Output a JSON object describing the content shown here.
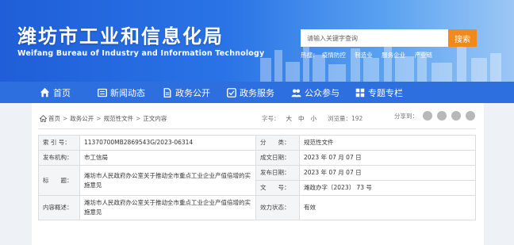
{
  "header": {
    "title": "潍坊市工业和信息化局",
    "subtitle": "Weifang Bureau of Industry and Information Technology",
    "search_placeholder": "请输入关键字查询",
    "search_button": "搜索",
    "hot_label": "热搜：",
    "hot_items": [
      "疫情防控",
      "制造业",
      "服务企业",
      "产业链"
    ]
  },
  "nav": {
    "items": [
      {
        "label": "首页",
        "icon": "home-icon"
      },
      {
        "label": "新闻动态",
        "icon": "news-icon"
      },
      {
        "label": "政务公开",
        "icon": "document-icon"
      },
      {
        "label": "政务服务",
        "icon": "service-icon"
      },
      {
        "label": "公众参与",
        "icon": "people-icon"
      },
      {
        "label": "专题专栏",
        "icon": "topic-icon"
      }
    ]
  },
  "breadcrumb": {
    "items": [
      "首页",
      "政务公开",
      "规范性文件",
      "正文内容"
    ],
    "sep": ">"
  },
  "tools": {
    "font_label": "字号：",
    "font_large": "大",
    "font_medium": "中",
    "font_small": "小",
    "views_label": "浏览量：",
    "views": "192",
    "share_label": "分享到："
  },
  "info": {
    "index_label": "索 引 号：",
    "index_value": "11370700MB2869543G/2023-06314",
    "category_label": "分　　类：",
    "category_value": "规范性文件",
    "publisher_label": "发布机构：",
    "publisher_value": "市工信局",
    "date_created_label": "成文日期：",
    "date_created_value": "2023 年 07 月 07 日",
    "title_label": "标　　题：",
    "title_value": "潍坊市人民政府办公室关于推动全市重点工业企业产值倍增的实施意见",
    "date_published_label": "发布日期：",
    "date_published_value": "2023 年 07 月 07 日",
    "doc_number_label": "文　　号：",
    "doc_number_value": "潍政办字〔2023〕 73 号",
    "overview_label": "内容概述：",
    "overview_value": "潍坊市人民政府办公室关于推动全市重点工业企业产值倍增的实施意见",
    "status_label": "效力状态：",
    "status_value": "有效"
  },
  "colors": {
    "header_blue": "#2a74e6",
    "nav_blue": "#2e6fe0",
    "search_orange": "#f08a1c"
  }
}
